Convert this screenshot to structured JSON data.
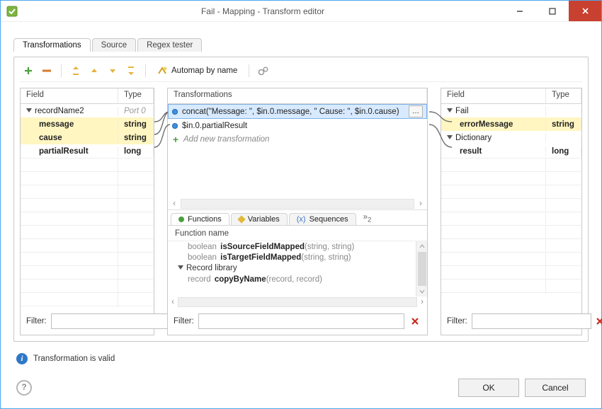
{
  "window": {
    "title": "Fail - Mapping - Transform editor"
  },
  "tabs": {
    "t1": "Transformations",
    "t2": "Source",
    "t3": "Regex tester"
  },
  "toolbar": {
    "automap": "Automap by name"
  },
  "leftPanel": {
    "hdrField": "Field",
    "hdrType": "Type",
    "portName": "recordName2",
    "portLabel": "Port 0",
    "rows": [
      {
        "name": "message",
        "type": "string"
      },
      {
        "name": "cause",
        "type": "string"
      },
      {
        "name": "partialResult",
        "type": "long"
      }
    ]
  },
  "midPanel": {
    "header": "Transformations",
    "items": [
      {
        "text": "concat(\"Message: \", $in.0.message, \" Cause: \", $in.0.cause)"
      },
      {
        "text": "$in.0.partialResult"
      }
    ],
    "addNew": "Add new transformation",
    "subtabs": {
      "functions": "Functions",
      "variables": "Variables",
      "sequences": "Sequences",
      "overflowCount": "2"
    },
    "funcHeader": "Function name",
    "funcLines": [
      {
        "ret": "boolean",
        "name": "isSourceFieldMapped",
        "params": "(string, string)"
      },
      {
        "ret": "boolean",
        "name": "isTargetFieldMapped",
        "params": "(string, string)"
      }
    ],
    "group": "Record library",
    "funcLines2": [
      {
        "ret": "record",
        "name": "copyByName",
        "params": "(record, record)"
      }
    ]
  },
  "rightPanel": {
    "hdrField": "Field",
    "hdrType": "Type",
    "group1": "Fail",
    "row1": {
      "name": "errorMessage",
      "type": "string"
    },
    "group2": "Dictionary",
    "row2": {
      "name": "result",
      "type": "long"
    }
  },
  "filterLabel": "Filter:",
  "status": "Transformation is valid",
  "buttons": {
    "ok": "OK",
    "cancel": "Cancel"
  }
}
